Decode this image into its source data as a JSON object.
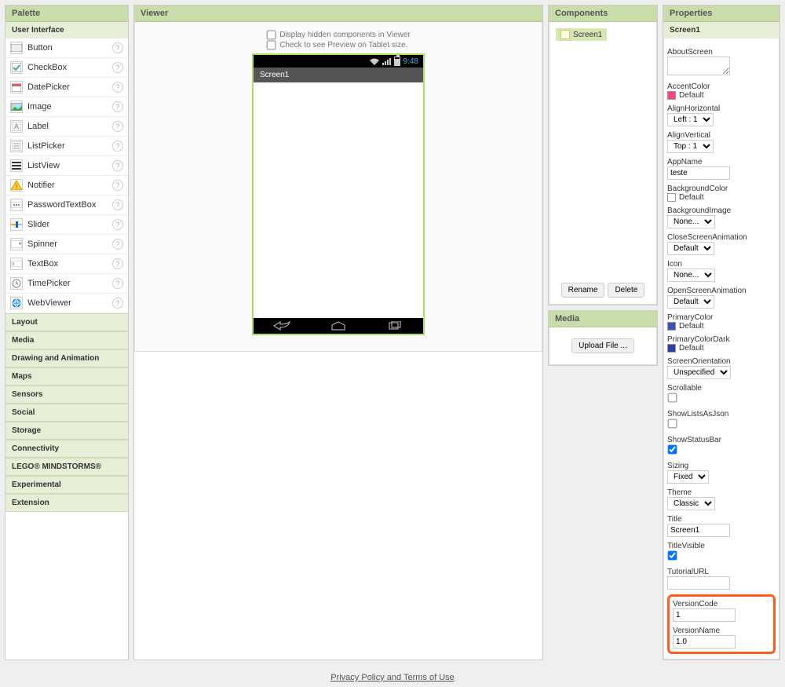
{
  "palette": {
    "title": "Palette",
    "ui_header": "User Interface",
    "items": [
      "Button",
      "CheckBox",
      "DatePicker",
      "Image",
      "Label",
      "ListPicker",
      "ListView",
      "Notifier",
      "PasswordTextBox",
      "Slider",
      "Spinner",
      "TextBox",
      "TimePicker",
      "WebViewer"
    ],
    "categories": [
      "Layout",
      "Media",
      "Drawing and Animation",
      "Maps",
      "Sensors",
      "Social",
      "Storage",
      "Connectivity",
      "LEGO® MINDSTORMS®",
      "Experimental",
      "Extension"
    ]
  },
  "viewer": {
    "title": "Viewer",
    "opt_hidden": "Display hidden components in Viewer",
    "opt_tablet": "Check to see Preview on Tablet size.",
    "clock": "9:48",
    "screen_title": "Screen1"
  },
  "components": {
    "title": "Components",
    "selected": "Screen1",
    "rename": "Rename",
    "delete": "Delete"
  },
  "media": {
    "title": "Media",
    "upload": "Upload File ..."
  },
  "properties": {
    "title": "Properties",
    "screen": "Screen1",
    "labels": {
      "about": "AboutScreen",
      "accent": "AccentColor",
      "alignH": "AlignHorizontal",
      "alignV": "AlignVertical",
      "appname": "AppName",
      "bgcolor": "BackgroundColor",
      "bgimage": "BackgroundImage",
      "closeanim": "CloseScreenAnimation",
      "icon": "Icon",
      "openanim": "OpenScreenAnimation",
      "primcolor": "PrimaryColor",
      "primdark": "PrimaryColorDark",
      "orient": "ScreenOrientation",
      "scroll": "Scrollable",
      "lists": "ShowListsAsJson",
      "statusbar": "ShowStatusBar",
      "sizing": "Sizing",
      "theme": "Theme",
      "titleprop": "Title",
      "titlevis": "TitleVisible",
      "tutorial": "TutorialURL",
      "vcode": "VersionCode",
      "vname": "VersionName"
    },
    "values": {
      "default": "Default",
      "alignH": "Left : 1",
      "alignV": "Top : 1",
      "appname": "teste",
      "none": "None...",
      "orient": "Unspecified",
      "sizing": "Fixed",
      "theme": "Classic",
      "title": "Screen1",
      "vcode": "1",
      "vname": "1.0"
    }
  },
  "footer": "Privacy Policy and Terms of Use"
}
